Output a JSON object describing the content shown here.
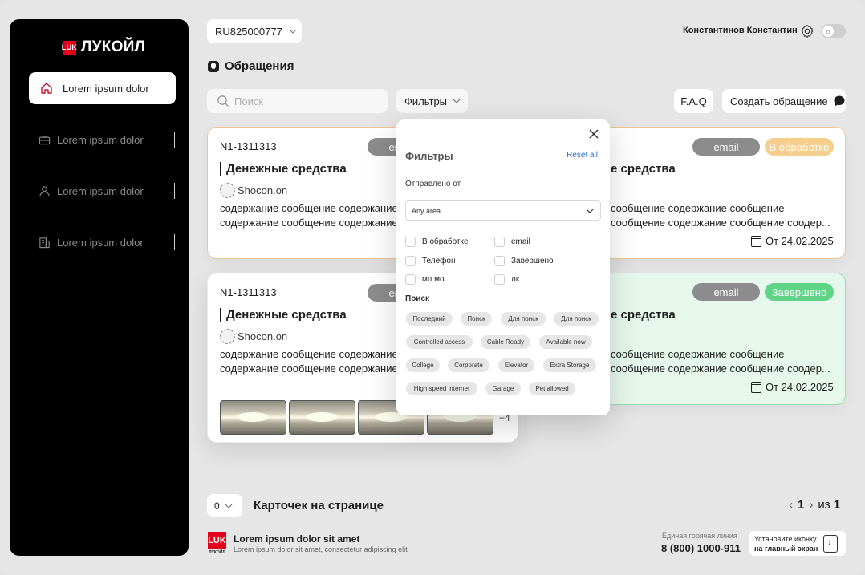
{
  "brand": {
    "name": "ЛУКОЙЛ",
    "mark": "LUK",
    "accent": "#e3001b"
  },
  "sidebar": {
    "items": [
      {
        "label": "Lorem ipsum dolor",
        "icon": "home-icon",
        "active": true
      },
      {
        "label": "Lorem ipsum dolor",
        "icon": "briefcase-icon",
        "active": false
      },
      {
        "label": "Lorem ipsum dolor",
        "icon": "user-icon",
        "active": false
      },
      {
        "label": "Lorem ipsum dolor",
        "icon": "building-icon",
        "active": false
      }
    ]
  },
  "header": {
    "account": "RU825000777",
    "user_name": "Константинов Константин",
    "page_title": "Обращения"
  },
  "toolbar": {
    "search_placeholder": "Поиск",
    "filters_label": "Фильтры",
    "faq_label": "F.A.Q",
    "create_label": "Создать обращение"
  },
  "cards": [
    {
      "number": "N1-1311313",
      "title": "Денежные средства",
      "org": "Shocon.on",
      "body1": "содержание сообщение содержание сообщение",
      "body2": "содержание сообщение содержание сообщение соодер...",
      "channel": "email",
      "status": "В обработке",
      "date": "От 24.02.2025"
    },
    {
      "number": "N1-1311313",
      "title": "Денежные средства",
      "org": "Shocon.on",
      "body1": "содержание сообщение содержание сообщение",
      "body2": "содержание сообщение содержание сообщение соодер...",
      "channel": "email",
      "status": "Завершено",
      "date": "От 24.02.2025",
      "more_photos": "+4"
    }
  ],
  "filter_popup": {
    "title": "Фильтры",
    "reset": "Reset all",
    "sent_from_label": "Отправлено от",
    "area_value": "Any area",
    "checks": [
      "В обработке",
      "email",
      "Телефон",
      "Завершено",
      "мп мо",
      "лк"
    ],
    "search_label": "Поиск",
    "chips": [
      "Последний",
      "Поиск",
      "Для поиск",
      "Для поиск",
      "Controlled access",
      "Cable Ready",
      "Available now",
      "College",
      "Corporate",
      "Elevator",
      "Extra Storage",
      "High speed internet",
      "Garage",
      "Pet allowed"
    ]
  },
  "pagination": {
    "per_page_value": "0",
    "per_page_label": "Карточек на странице",
    "current": "1",
    "of_label": "из",
    "total": "1"
  },
  "footer": {
    "logo_text": "ЛУКОЙЛ",
    "title": "Lorem ipsum dolor sit amet",
    "subtitle": "Lorem ipsum dolor sit amet, consectetur adipiscing elit",
    "hotline_label": "Единая горячая линия",
    "hotline_number": "8 (800) 1000-911",
    "install_line1": "Установите иконку",
    "install_line2": "на главный экран"
  },
  "colors": {
    "status_processing_bg": "#f6cf8e",
    "status_done_bg": "#5fd486",
    "channel_badge_bg": "#8c8c8c",
    "link": "#2c6bdc"
  }
}
